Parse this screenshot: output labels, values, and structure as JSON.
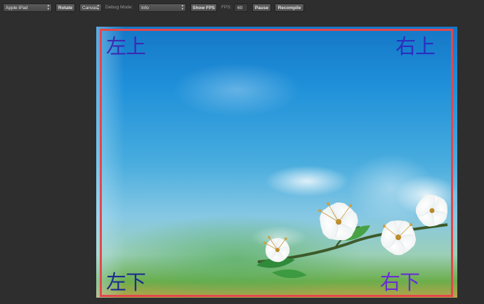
{
  "toolbar": {
    "device_select": "Apple iPad",
    "rotate_label": "Rotate",
    "renderer_select": "Canvas",
    "debug_mode_label": "Debug Mode:",
    "debug_mode_select": "Info",
    "show_fps_label": "Show FPS",
    "fps_label": "FPS:",
    "fps_value": "60",
    "pause_label": "Pause",
    "recompile_label": "Recompile"
  },
  "stage": {
    "corner_top_left": "左上",
    "corner_top_right": "右上",
    "corner_bottom_left": "左下",
    "corner_bottom_right": "右下",
    "frame_color": "#e3474d"
  },
  "icons": {
    "select_arrows": "up-down-arrows-icon"
  }
}
